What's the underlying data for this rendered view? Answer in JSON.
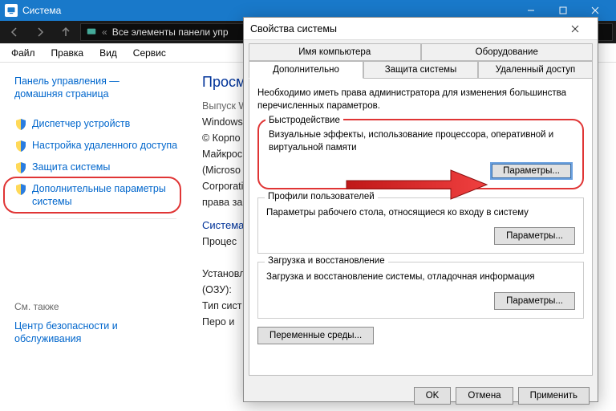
{
  "back": {
    "title": "Система",
    "breadcrumb": "Все элементы панели упр",
    "menu": {
      "file": "Файл",
      "edit": "Правка",
      "view": "Вид",
      "service": "Сервис"
    },
    "sidebar": {
      "home1": "Панель управления —",
      "home2": "домашняя страница",
      "device_mgr": "Диспетчер устройств",
      "remote": "Настройка удаленного доступа",
      "protection": "Защита системы",
      "advanced": "Дополнительные параметры системы",
      "see_also": "См. также",
      "security": "Центр безопасности и обслуживания"
    },
    "content": {
      "heading": "Просмот",
      "release": "Выпуск Win",
      "windows": "Windows",
      "corp1": "© Корпо",
      "corp2": "Майкрос",
      "corp3": "(Microso",
      "corp4": "Corporati",
      "corp5": "права за",
      "system": "Система",
      "proc": "Процес",
      "ram1": "Установл",
      "ram2": "(ОЗУ):",
      "type": "Тип сист",
      "pen": "Перо и"
    }
  },
  "dialog": {
    "title": "Свойства системы",
    "tabs": {
      "computer_name": "Имя компьютера",
      "hardware": "Оборудование",
      "advanced": "Дополнительно",
      "protection": "Защита системы",
      "remote": "Удаленный доступ"
    },
    "intro": "Необходимо иметь права администратора для изменения большинства перечисленных параметров.",
    "perf": {
      "title": "Быстродействие",
      "body": "Визуальные эффекты, использование процессора, оперативной и виртуальной памяти",
      "btn": "Параметры..."
    },
    "profiles": {
      "title": "Профили пользователей",
      "body": "Параметры рабочего стола, относящиеся ко входу в систему",
      "btn": "Параметры..."
    },
    "recovery": {
      "title": "Загрузка и восстановление",
      "body": "Загрузка и восстановление системы, отладочная информация",
      "btn": "Параметры..."
    },
    "env_btn": "Переменные среды...",
    "ok": "OK",
    "cancel": "Отмена",
    "apply": "Применить"
  }
}
